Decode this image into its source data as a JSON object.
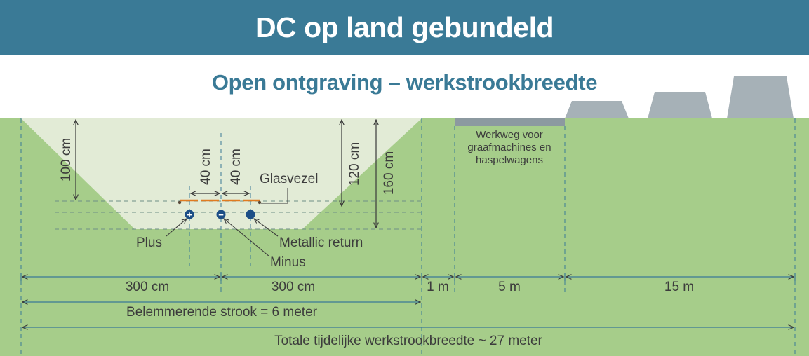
{
  "header": {
    "title": "DC op land gebundeld"
  },
  "subtitle": "Open ontgraving – werkstrookbreedte",
  "colors": {
    "header": "#3a7a96",
    "ground": "#a6cd8a",
    "trench": "#e2ebd6",
    "road": "#8c99a0",
    "machines": "#a6b1b7",
    "cable": "#1c4e86",
    "fiber": "#e07b21"
  },
  "depths": {
    "d100": "100 cm",
    "d120": "120 cm",
    "d160": "160 cm"
  },
  "spacing": {
    "left": "40 cm",
    "right": "40 cm"
  },
  "labels": {
    "glasvezel": "Glasvezel",
    "plus": "Plus",
    "minus": "Minus",
    "metallic": "Metallic return",
    "road_line1": "Werkweg voor",
    "road_line2": "graafmachines en",
    "road_line3": "haspelwagens"
  },
  "widths": {
    "w300a": "300 cm",
    "w300b": "300 cm",
    "w1m": "1 m",
    "w5m": "5 m",
    "w15m": "15 m",
    "strook": "Belemmerende strook = 6 meter",
    "totaal": "Totale tijdelijke werkstrookbreedte ~ 27 meter"
  },
  "symbols": {
    "plus": "+",
    "minus": "−"
  }
}
